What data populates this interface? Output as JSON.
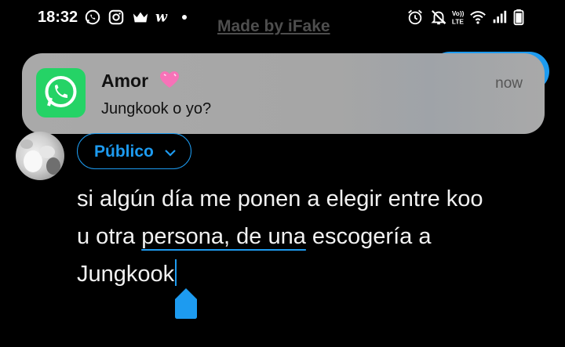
{
  "status_bar": {
    "time": "18:32",
    "icons_left": [
      "whatsapp-icon",
      "instagram-icon",
      "crown-icon",
      "app-w-icon"
    ],
    "icons_right": [
      "alarm-icon",
      "mute-icon",
      "volte-icon",
      "wifi-icon",
      "signal-icon",
      "battery-icon"
    ],
    "volte_label": "Vo)) LTE"
  },
  "watermark": "Made by iFake",
  "notification": {
    "app": "whatsapp",
    "title": "Amor",
    "emoji": "💗",
    "message": "Jungkook o yo?",
    "time": "now"
  },
  "compose": {
    "audience_label": "Público",
    "text_lines": [
      "si algún día me ponen a elegir entre koo",
      "u otra ",
      "persona, de una",
      " escogería a",
      "Jungkook"
    ]
  },
  "colors": {
    "accent": "#1d9bf0",
    "notification_bg": "#a6a6a6",
    "whatsapp_green": "#25d366",
    "background": "#000000"
  }
}
